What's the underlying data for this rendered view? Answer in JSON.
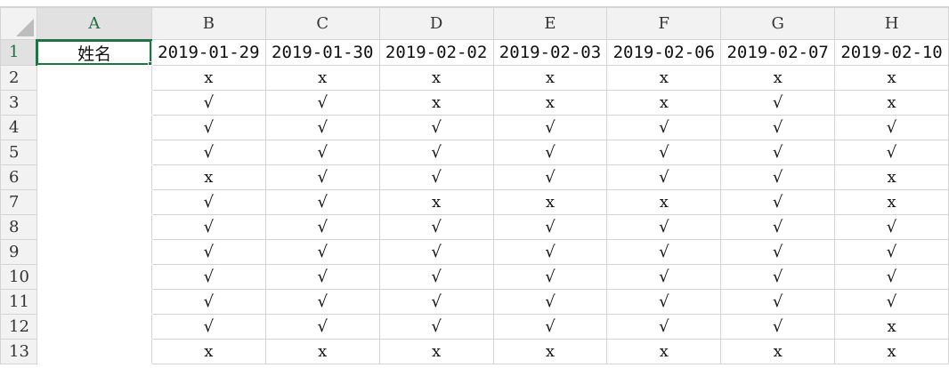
{
  "columns": [
    "A",
    "B",
    "C",
    "D",
    "E",
    "F",
    "G",
    "H"
  ],
  "rows": [
    "1",
    "2",
    "3",
    "4",
    "5",
    "6",
    "7",
    "8",
    "9",
    "10",
    "11",
    "12",
    "13"
  ],
  "header_row": {
    "name": "姓名",
    "dates": [
      "2019-01-29",
      "2019-01-30",
      "2019-02-02",
      "2019-02-03",
      "2019-02-06",
      "2019-02-07",
      "2019-02-10"
    ]
  },
  "marks": [
    [
      "x",
      "x",
      "x",
      "x",
      "x",
      "x",
      "x"
    ],
    [
      "√",
      "√",
      "x",
      "x",
      "x",
      "√",
      "x"
    ],
    [
      "√",
      "√",
      "√",
      "√",
      "√",
      "√",
      "√"
    ],
    [
      "√",
      "√",
      "√",
      "√",
      "√",
      "√",
      "√"
    ],
    [
      "x",
      "√",
      "√",
      "√",
      "√",
      "√",
      "x"
    ],
    [
      "√",
      "√",
      "x",
      "x",
      "x",
      "√",
      "x"
    ],
    [
      "√",
      "√",
      "√",
      "√",
      "√",
      "√",
      "√"
    ],
    [
      "√",
      "√",
      "√",
      "√",
      "√",
      "√",
      "√"
    ],
    [
      "√",
      "√",
      "√",
      "√",
      "√",
      "√",
      "√"
    ],
    [
      "√",
      "√",
      "√",
      "√",
      "√",
      "√",
      "√"
    ],
    [
      "√",
      "√",
      "√",
      "√",
      "√",
      "√",
      "x"
    ],
    [
      "x",
      "x",
      "x",
      "x",
      "x",
      "x",
      "x"
    ]
  ],
  "colors": {
    "accent": "#217346",
    "header_bg": "#f2f2f2",
    "grid": "#d4d4d4"
  }
}
